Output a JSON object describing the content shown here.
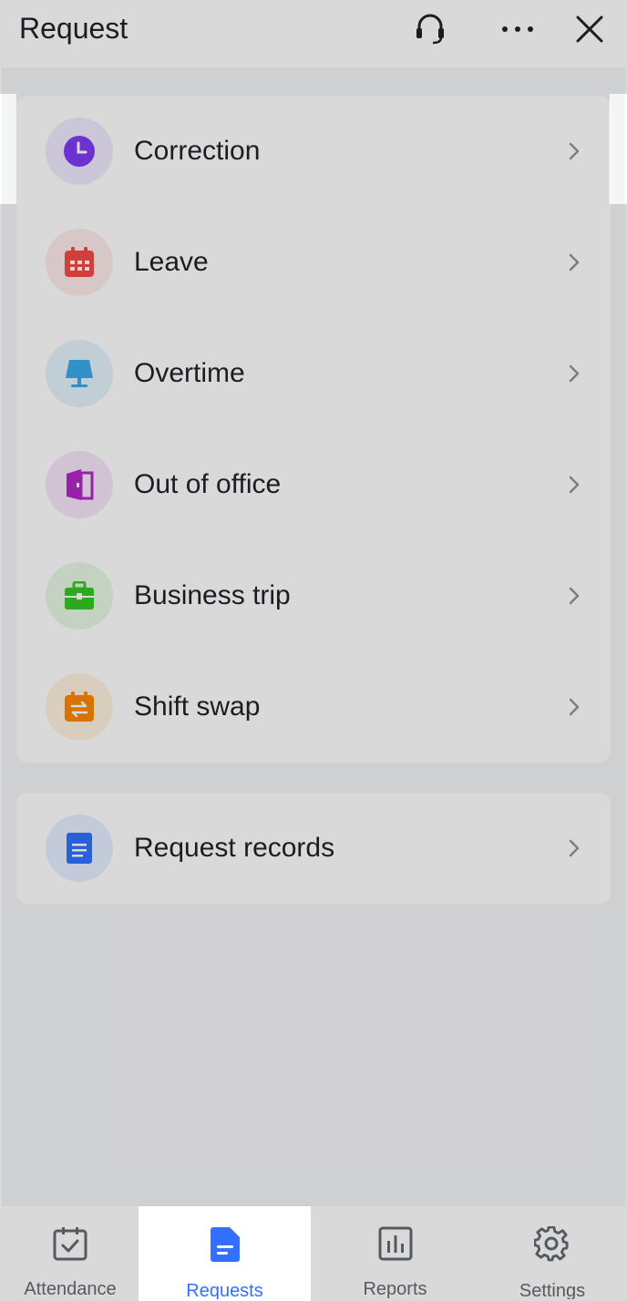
{
  "header": {
    "title": "Request",
    "icons": [
      "headset-icon",
      "more-icon",
      "close-icon"
    ]
  },
  "requests": [
    {
      "label": "Correction",
      "icon": "clock-icon",
      "color": "#7f3bf5",
      "bg": "#efeafe"
    },
    {
      "label": "Leave",
      "icon": "calendar-icon",
      "color": "#f54a45",
      "bg": "#fdecea"
    },
    {
      "label": "Overtime",
      "icon": "lamp-icon",
      "color": "#3daae8",
      "bg": "#e3f2fb"
    },
    {
      "label": "Out of office",
      "icon": "door-icon",
      "color": "#b427c8",
      "bg": "#f6e6f8"
    },
    {
      "label": "Business trip",
      "icon": "briefcase-icon",
      "color": "#34c724",
      "bg": "#e5f7e3"
    },
    {
      "label": "Shift swap",
      "icon": "swap-icon",
      "color": "#ff8800",
      "bg": "#fff1df"
    }
  ],
  "records": {
    "label": "Request records",
    "icon": "document-icon",
    "color": "#3370ff",
    "bg": "#e6eeff"
  },
  "tabs": [
    {
      "label": "Attendance",
      "icon": "calendar-check-icon",
      "active": false
    },
    {
      "label": "Requests",
      "icon": "document-icon",
      "active": true
    },
    {
      "label": "Reports",
      "icon": "bar-chart-icon",
      "active": false
    },
    {
      "label": "Settings",
      "icon": "gear-icon",
      "active": false
    }
  ],
  "colors": {
    "accent": "#3370ff",
    "text": "#1f2329",
    "muted": "#646a73",
    "overlay": "rgba(0,0,0,0.15)"
  }
}
